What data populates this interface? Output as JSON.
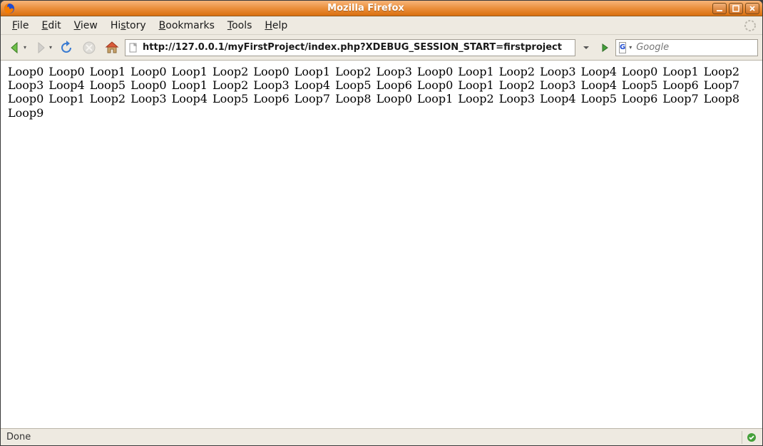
{
  "window": {
    "title": "Mozilla Firefox"
  },
  "menubar": {
    "file": "File",
    "edit": "Edit",
    "view": "View",
    "history": "History",
    "bookmarks": "Bookmarks",
    "tools": "Tools",
    "help": "Help"
  },
  "toolbar": {
    "url": "http://127.0.0.1/myFirstProject/index.php?XDEBUG_SESSION_START=firstproject",
    "search_placeholder": "Google",
    "search_engine_letter": "G"
  },
  "page": {
    "body": "Loop0 Loop0 Loop1 Loop0 Loop1 Loop2 Loop0 Loop1 Loop2 Loop3 Loop0 Loop1 Loop2 Loop3 Loop4 Loop0 Loop1 Loop2 Loop3 Loop4 Loop5 Loop0 Loop1 Loop2 Loop3 Loop4 Loop5 Loop6 Loop0 Loop1 Loop2 Loop3 Loop4 Loop5 Loop6 Loop7 Loop0 Loop1 Loop2 Loop3 Loop4 Loop5 Loop6 Loop7 Loop8 Loop0 Loop1 Loop2 Loop3 Loop4 Loop5 Loop6 Loop7 Loop8 Loop9"
  },
  "statusbar": {
    "text": "Done"
  }
}
